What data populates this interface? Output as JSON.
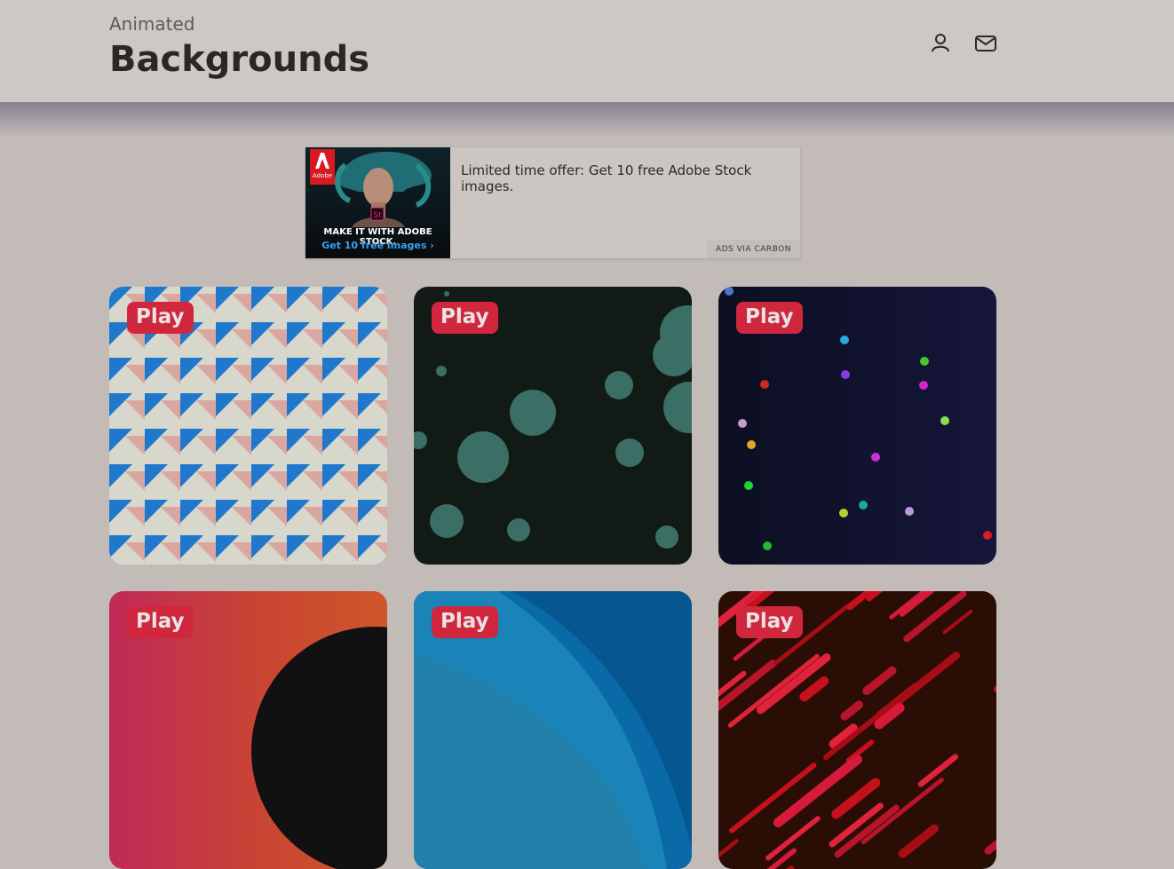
{
  "header": {
    "subtitle": "Animated",
    "title": "Backgrounds",
    "icons": [
      "user-icon",
      "mail-icon"
    ]
  },
  "ad": {
    "image_headline": "MAKE IT WITH ADOBE STOCK.",
    "image_cta": "Get 10 free images ›",
    "logo_text": "Adobe",
    "product_badge": "St",
    "text": "Limited time offer: Get 10 free Adobe Stock images.",
    "via": "ADS VIA CARBON"
  },
  "cards": [
    {
      "play_label": "Play"
    },
    {
      "play_label": "Play"
    },
    {
      "play_label": "Play"
    },
    {
      "play_label": "Play"
    },
    {
      "play_label": "Play"
    },
    {
      "play_label": "Play"
    }
  ],
  "colors": {
    "play_badge": "#d0273e",
    "page_background": "#c2bbb8",
    "header_background": "#cdc8c3"
  }
}
